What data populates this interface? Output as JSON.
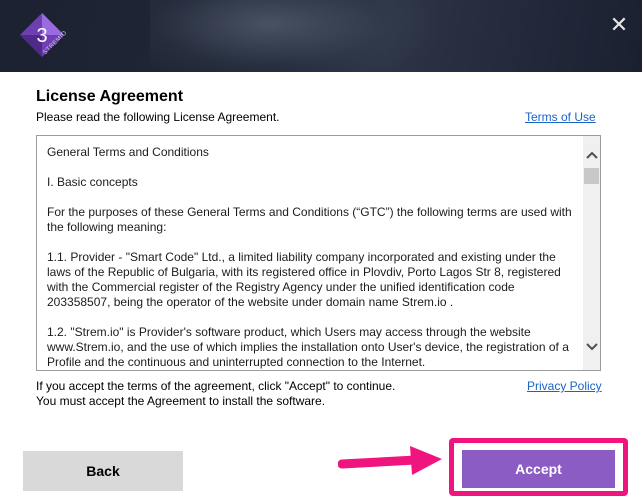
{
  "header": {
    "logo_glyph": "3",
    "logo_subtext": "STREMIO",
    "close_glyph": "✕"
  },
  "title": "License Agreement",
  "subtitle": "Please read the following License Agreement.",
  "links": {
    "terms": "Terms of Use",
    "privacy": "Privacy Policy"
  },
  "agreement": {
    "paragraphs": [
      "General Terms and Conditions",
      "I. Basic concepts",
      "For the purposes of these General Terms and Conditions (“GTC”) the following terms are used with the following meaning:",
      "1.1. Provider - \"Smart Code\" Ltd., a limited liability company incorporated and existing under the laws of the Republic of Bulgaria, with its registered office in Plovdiv, Porto Lagos Str 8, registered with the Commercial register of the Registry Agency under the unified identification code 203358507, being the operator of the website under domain name Strem.io .",
      "1.2. \"Strem.io\" is Provider's software product, which Users may access through the website www.Strem.io, and the use of which implies the installation onto User's device, the registration of a Profile and the continuous and uninterrupted connection to the Internet."
    ]
  },
  "note": {
    "line1": "If you accept the terms of the agreement, click \"Accept\" to continue.",
    "line2": "You must accept the Agreement to install the software."
  },
  "buttons": {
    "back": "Back",
    "accept": "Accept"
  },
  "colors": {
    "accent": "#8a5cc4",
    "highlight": "#f0157e",
    "link": "#1a64c8"
  }
}
